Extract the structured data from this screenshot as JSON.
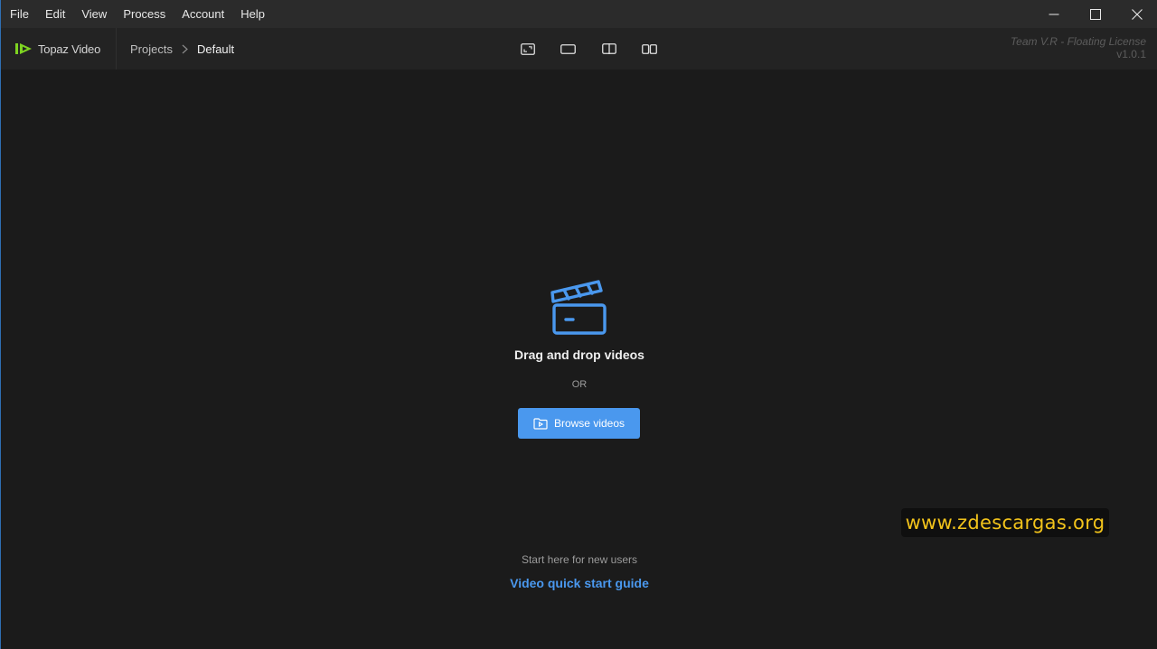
{
  "menu": {
    "items": [
      {
        "label": "File"
      },
      {
        "label": "Edit"
      },
      {
        "label": "View"
      },
      {
        "label": "Process"
      },
      {
        "label": "Account"
      },
      {
        "label": "Help"
      }
    ]
  },
  "window_controls": {
    "icons": [
      "minimize-icon",
      "maximize-icon",
      "close-icon"
    ]
  },
  "header": {
    "brand": "Topaz Video",
    "breadcrumb": {
      "projects": "Projects",
      "current": "Default"
    },
    "view_modes": [
      "single-view-crop-icon",
      "single-view-icon",
      "split-view-icon",
      "side-by-side-view-icon"
    ],
    "license": "Team V.R - Floating License",
    "version": "v1.0.1"
  },
  "main": {
    "drop_title": "Drag and drop videos",
    "or_text": "OR",
    "browse_label": "Browse videos",
    "start_hint": "Start here for new users",
    "guide_link": "Video quick start guide"
  },
  "watermark": {
    "text": "www.zdescargas.org"
  },
  "colors": {
    "accent": "#4a98ee",
    "brand_green": "#7ed321",
    "background": "#1b1b1b",
    "watermark_text": "#f2c31b"
  }
}
